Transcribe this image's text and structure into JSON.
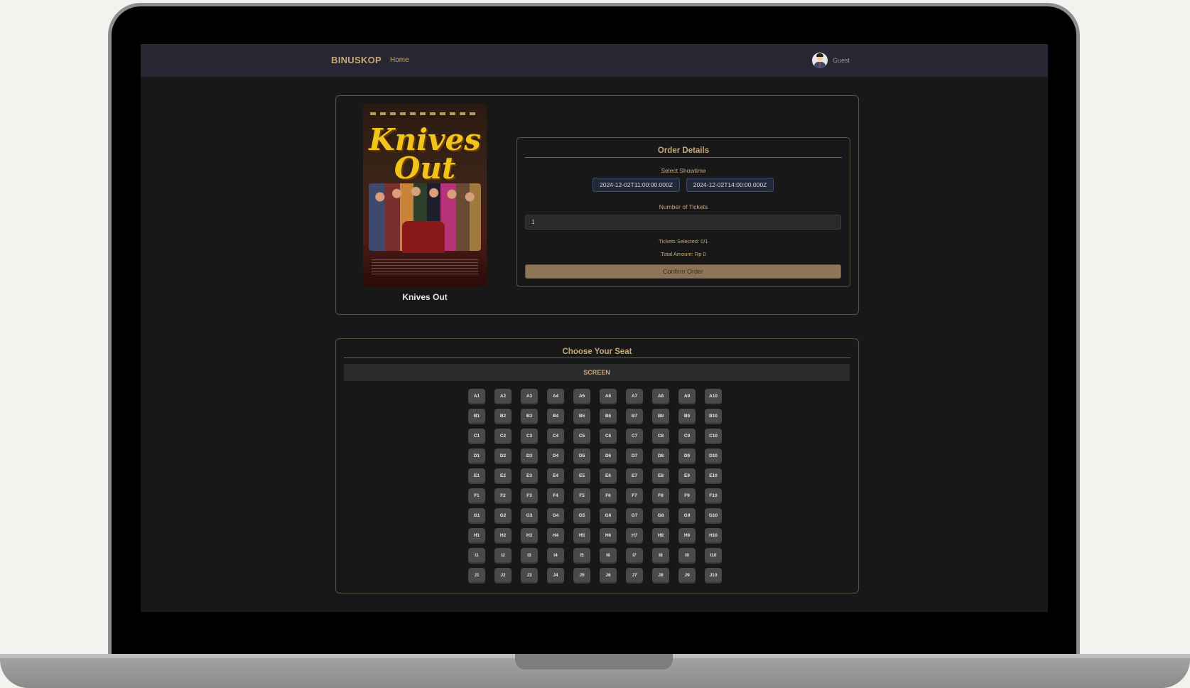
{
  "nav": {
    "brand": "BINUSKOP",
    "home": "Home",
    "user": "Guest"
  },
  "movie": {
    "title": "Knives Out",
    "poster_title_line1": "Knives",
    "poster_title_line2": "Out"
  },
  "order": {
    "title": "Order Details",
    "showtime_label": "Select Showtime",
    "showtimes": [
      "2024-12-02T11:00:00.000Z",
      "2024-12-02T14:00:00.000Z"
    ],
    "tickets_label": "Number of Tickets",
    "tickets_value": "1",
    "tickets_selected": "Tickets Selected: 0/1",
    "total_amount": "Total Amount: Rp 0",
    "confirm_label": "Confirm Order"
  },
  "seats": {
    "title": "Choose Your Seat",
    "screen_label": "SCREEN",
    "rows": [
      "A",
      "B",
      "C",
      "D",
      "E",
      "F",
      "G",
      "H",
      "I",
      "J"
    ],
    "columns": 10
  },
  "colors": {
    "accent": "#c9a878",
    "confirm": "#8d7557",
    "seat": "#4a4a4a",
    "navbar": "#262733"
  }
}
